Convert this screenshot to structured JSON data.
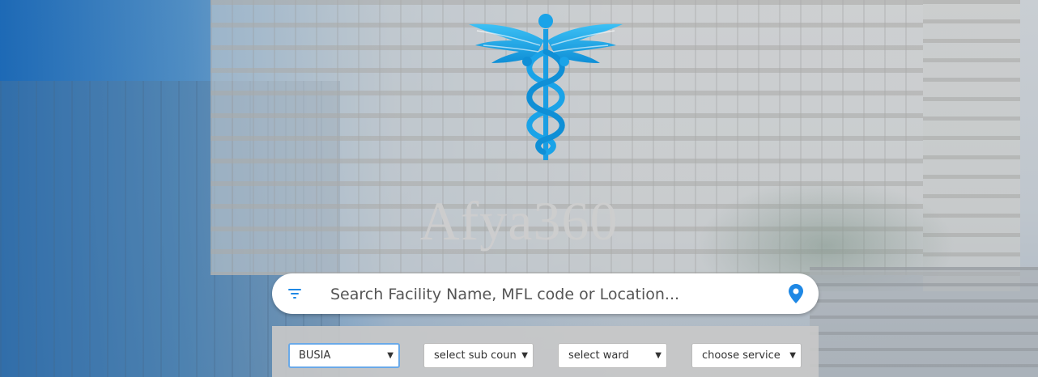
{
  "brand": {
    "name": "Afya360"
  },
  "icons": {
    "logo": "caduceus-icon",
    "filter": "filter-icon",
    "location": "location-pin-icon",
    "dropdown": "caret-down-icon"
  },
  "colors": {
    "accent": "#1aa3e8",
    "pin": "#1e88e5",
    "brand_text": "#cdcdcd"
  },
  "search": {
    "placeholder": "Search Facility Name, MFL code or Location..."
  },
  "filters": {
    "county": {
      "value": "BUSIA"
    },
    "subcounty": {
      "value": "select sub coun"
    },
    "ward": {
      "value": "select ward"
    },
    "service": {
      "value": "choose service"
    }
  }
}
